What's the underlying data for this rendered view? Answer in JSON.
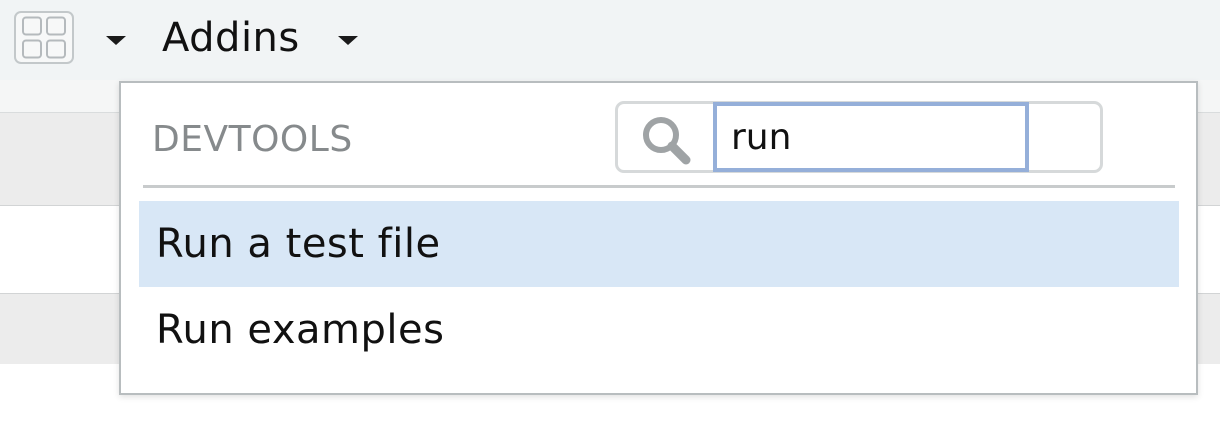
{
  "toolbar": {
    "addins_label": "Addins",
    "icons": [
      "grid-icon",
      "chevron-down-icon"
    ]
  },
  "popup": {
    "section_label": "DEVTOOLS",
    "search": {
      "value": "run",
      "placeholder": ""
    },
    "items": [
      {
        "label": "Run a test file",
        "selected": true
      },
      {
        "label": "Run examples",
        "selected": false
      }
    ]
  },
  "colors": {
    "toolbar_bg": "#f1f4f5",
    "selected_item_bg": "#d8e7f6",
    "input_focus_border": "#95afd9",
    "section_label": "#868a8c"
  }
}
